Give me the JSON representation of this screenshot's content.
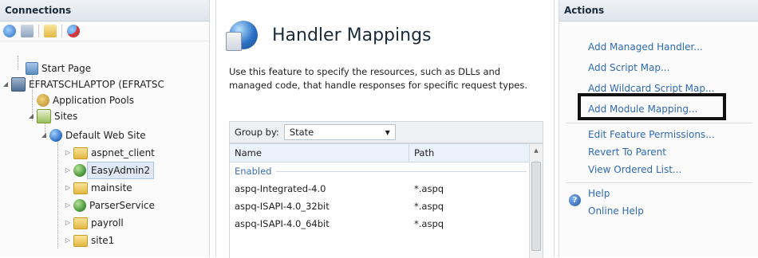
{
  "connections": {
    "title": "Connections",
    "tree": [
      {
        "label": "Start Page",
        "icon": "start-page-icon"
      },
      {
        "label": "EFRATSCHLAPTOP (EFRATSC",
        "icon": "server-icon"
      },
      {
        "label": "Application Pools",
        "icon": "application-pools-icon"
      },
      {
        "label": "Sites",
        "icon": "sites-icon"
      },
      {
        "label": "Default Web Site",
        "icon": "web-site-icon"
      },
      {
        "label": "aspnet_client",
        "icon": "folder-icon"
      },
      {
        "label": "EasyAdmin2",
        "icon": "application-icon"
      },
      {
        "label": "mainsite",
        "icon": "folder-icon"
      },
      {
        "label": "ParserService",
        "icon": "application-icon"
      },
      {
        "label": "payroll",
        "icon": "folder-icon"
      },
      {
        "label": "site1",
        "icon": "folder-icon"
      }
    ]
  },
  "center": {
    "title": "Handler Mappings",
    "description": "Use this feature to specify the resources, such as DLLs and managed code, that handle responses for specific request types.",
    "group_by_label": "Group by:",
    "group_by_value": "State",
    "columns": {
      "name": "Name",
      "path": "Path"
    },
    "group": "Enabled",
    "rows": [
      {
        "name": "aspq-Integrated-4.0",
        "path": "*.aspq"
      },
      {
        "name": "aspq-ISAPI-4.0_32bit",
        "path": "*.aspq"
      },
      {
        "name": "aspq-ISAPI-4.0_64bit",
        "path": "*.aspq"
      }
    ]
  },
  "actions": {
    "title": "Actions",
    "items": [
      "Add Managed Handler...",
      "Add Script Map...",
      "Add Wildcard Script Map...",
      "Add Module Mapping...",
      "Edit Feature Permissions...",
      "Revert To Parent",
      "View Ordered List...",
      "Help",
      "Online Help"
    ]
  },
  "colors": {
    "link": "#2e6ab3",
    "group_text": "#3b6fb6",
    "header_bg": "#dfe5ec",
    "selection": "#dfe8f5"
  }
}
